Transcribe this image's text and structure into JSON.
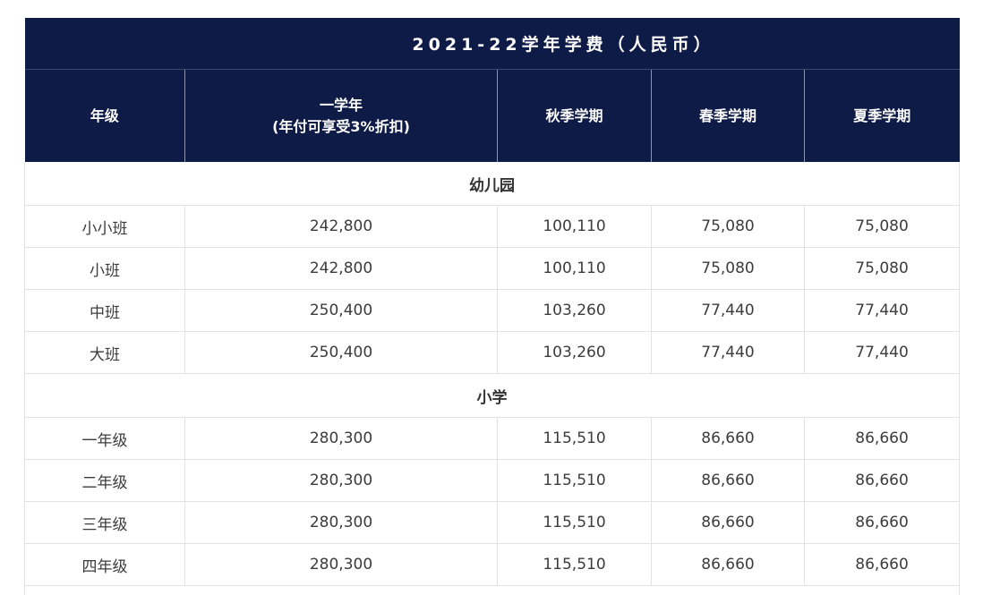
{
  "table": {
    "title": "2021-22学年学费（人民币）",
    "headers": {
      "grade": "年级",
      "full_year_line1": "一学年",
      "full_year_line2": "(年付可享受3%折扣)",
      "autumn": "秋季学期",
      "spring": "春季学期",
      "summer": "夏季学期"
    },
    "sections": [
      {
        "name": "幼儿园",
        "rows": [
          {
            "grade": "小小班",
            "full_year": "242,800",
            "autumn": "100,110",
            "spring": "75,080",
            "summer": "75,080"
          },
          {
            "grade": "小班",
            "full_year": "242,800",
            "autumn": "100,110",
            "spring": "75,080",
            "summer": "75,080"
          },
          {
            "grade": "中班",
            "full_year": "250,400",
            "autumn": "103,260",
            "spring": "77,440",
            "summer": "77,440"
          },
          {
            "grade": "大班",
            "full_year": "250,400",
            "autumn": "103,260",
            "spring": "77,440",
            "summer": "77,440"
          }
        ]
      },
      {
        "name": "小学",
        "rows": [
          {
            "grade": "一年级",
            "full_year": "280,300",
            "autumn": "115,510",
            "spring": "86,660",
            "summer": "86,660"
          },
          {
            "grade": "二年级",
            "full_year": "280,300",
            "autumn": "115,510",
            "spring": "86,660",
            "summer": "86,660"
          },
          {
            "grade": "三年级",
            "full_year": "280,300",
            "autumn": "115,510",
            "spring": "86,660",
            "summer": "86,660"
          },
          {
            "grade": "四年级",
            "full_year": "280,300",
            "autumn": "115,510",
            "spring": "86,660",
            "summer": "86,660"
          }
        ]
      }
    ]
  }
}
